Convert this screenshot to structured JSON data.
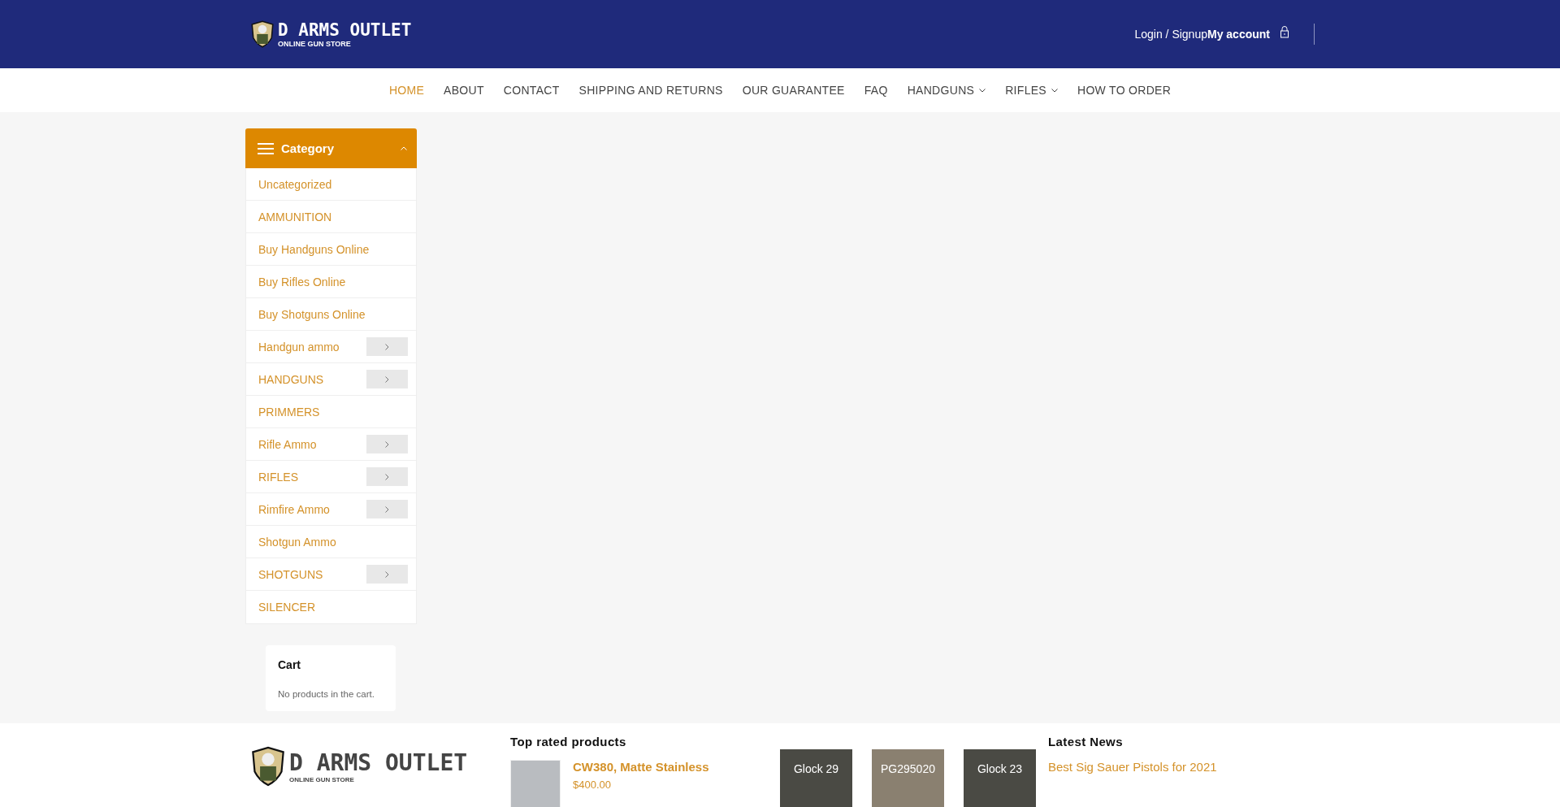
{
  "header": {
    "logo": {
      "name": "D ARMS OUTLET",
      "tagline": "ONLINE GUN STORE"
    },
    "login": "Login / Signup",
    "account": "My account"
  },
  "nav": [
    {
      "label": "HOME",
      "selected": true,
      "has_submenu": false
    },
    {
      "label": "ABOUT",
      "selected": false,
      "has_submenu": false
    },
    {
      "label": "CONTACT",
      "selected": false,
      "has_submenu": false
    },
    {
      "label": "SHIPPING AND RETURNS",
      "selected": false,
      "has_submenu": false
    },
    {
      "label": "OUR GUARANTEE",
      "selected": false,
      "has_submenu": false
    },
    {
      "label": "FAQ",
      "selected": false,
      "has_submenu": false
    },
    {
      "label": "HANDGUNS",
      "selected": false,
      "has_submenu": true
    },
    {
      "label": "RIFLES",
      "selected": false,
      "has_submenu": true
    },
    {
      "label": "HOW TO ORDER",
      "selected": false,
      "has_submenu": false
    }
  ],
  "category": {
    "title": "Category",
    "expanded": true,
    "items": [
      {
        "label": "Uncategorized",
        "expandable": false
      },
      {
        "label": "AMMUNITION",
        "expandable": false
      },
      {
        "label": "Buy Handguns Online",
        "expandable": false
      },
      {
        "label": "Buy Rifles Online",
        "expandable": false
      },
      {
        "label": "Buy Shotguns Online",
        "expandable": false
      },
      {
        "label": "Handgun ammo",
        "expandable": true
      },
      {
        "label": "HANDGUNS",
        "expandable": true
      },
      {
        "label": "PRIMMERS",
        "expandable": false
      },
      {
        "label": "Rifle Ammo",
        "expandable": true
      },
      {
        "label": "RIFLES",
        "expandable": true
      },
      {
        "label": "Rimfire Ammo",
        "expandable": true
      },
      {
        "label": "Shotgun Ammo",
        "expandable": false
      },
      {
        "label": "SHOTGUNS",
        "expandable": true
      },
      {
        "label": "SILENCER",
        "expandable": false
      }
    ]
  },
  "cart": {
    "title": "Cart",
    "message": "No products in the cart."
  },
  "footer": {
    "logo": {
      "name": "D ARMS OUTLET",
      "tagline": "ONLINE GUN STORE"
    },
    "top_rated": {
      "title": "Top rated products",
      "products": [
        {
          "name": "CW380, Matte Stainless",
          "price": "$400.00"
        }
      ]
    },
    "gallery": [
      {
        "caption": "Glock 29"
      },
      {
        "caption": "PG295020"
      },
      {
        "caption": "Glock 23"
      }
    ],
    "news": {
      "title": "Latest News",
      "posts": [
        "Best Sig Sauer Pistols for 2021"
      ]
    }
  }
}
